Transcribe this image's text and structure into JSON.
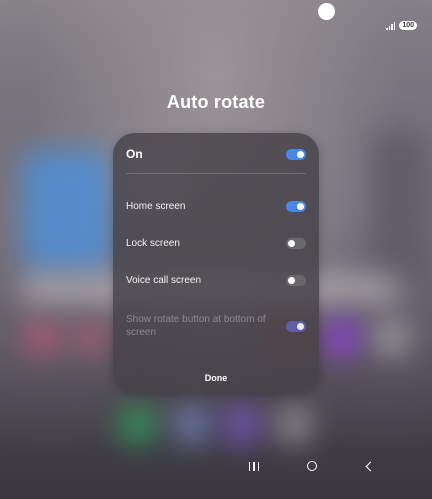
{
  "status_bar": {
    "battery": "100",
    "signal_icon": "signal-icon",
    "camera_icon": "front-camera-icon"
  },
  "title": "Auto rotate",
  "card": {
    "master": {
      "label": "On",
      "enabled": true
    },
    "items": [
      {
        "label": "Home screen",
        "enabled": true,
        "disabled": false
      },
      {
        "label": "Lock screen",
        "enabled": false,
        "disabled": false
      },
      {
        "label": "Voice call screen",
        "enabled": false,
        "disabled": false
      },
      {
        "label": "Show rotate button at bottom of screen",
        "enabled": true,
        "disabled": true
      }
    ],
    "done_label": "Done"
  },
  "nav": {
    "recents_icon": "recents-icon",
    "home_icon": "home-icon",
    "back_icon": "back-icon"
  },
  "colors": {
    "toggle_on": "#4a86e8",
    "toggle_off": "#6a676c",
    "card_bg": "#464248"
  }
}
